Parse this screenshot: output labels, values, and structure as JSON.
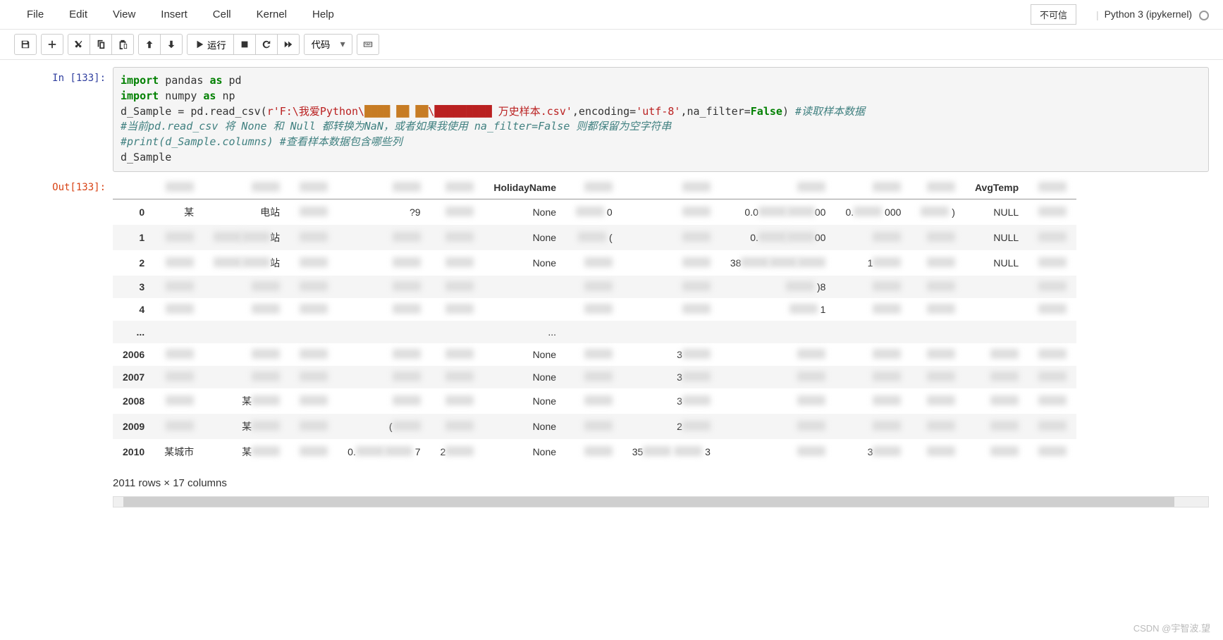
{
  "menubar": {
    "file": "File",
    "edit": "Edit",
    "view": "View",
    "insert": "Insert",
    "cell": "Cell",
    "kernel": "Kernel",
    "help": "Help",
    "trusted": "不可信",
    "kernel_name": "Python 3 (ipykernel)"
  },
  "toolbar": {
    "run_label": "运行",
    "cell_type": "代码"
  },
  "cell": {
    "in_prompt": "In  [133]:",
    "out_prompt": "Out[133]:",
    "code": {
      "l1_a": "import",
      "l1_b": " pandas ",
      "l1_c": "as",
      "l1_d": " pd",
      "l2_a": "import",
      "l2_b": " numpy ",
      "l2_c": "as",
      "l2_d": " np",
      "l3_a": "d_Sample = pd.read_csv(",
      "l3_b": "r'F:\\我爱Python\\",
      "l3_c": "████ ██ ██",
      "l3_d": "\\█████████ 万史样本.csv'",
      "l3_e": ",encoding=",
      "l3_f": "'utf-8'",
      "l3_g": ",na_filter=",
      "l3_h": "False",
      "l3_i": ") ",
      "l3_j": "#读取样本数据",
      "l4": "#当前pd.read_csv 将 None 和 Null 都转换为NaN，或者如果我使用 na_filter=False 则都保留为空字符串",
      "l5": "#print(d_Sample.columns) #查看样本数据包含哪些列",
      "l6": "d_Sample"
    }
  },
  "dataframe": {
    "headers": [
      "",
      "",
      "",
      "",
      "",
      "HolidayName",
      "",
      "",
      "",
      "",
      "",
      "AvgTemp",
      ""
    ],
    "rows": [
      {
        "idx": "0",
        "cells": [
          "某",
          "电站",
          "█",
          "?9",
          "█",
          "None",
          "█ 0",
          "█",
          "0.0██00",
          "0.█ 000",
          "█ )",
          "NULL",
          "█"
        ]
      },
      {
        "idx": "1",
        "cells": [
          "█",
          "██站",
          "█",
          "█",
          "█",
          "None",
          "█ (",
          "█",
          "0.██00",
          "█",
          "█",
          "NULL",
          "█"
        ]
      },
      {
        "idx": "2",
        "cells": [
          "█",
          "██站",
          "█",
          "█",
          "█",
          "None",
          "█",
          "█",
          "38███",
          "1█",
          "█",
          "NULL",
          "█"
        ]
      },
      {
        "idx": "3",
        "cells": [
          "█",
          "█",
          "█",
          "█",
          "█",
          "",
          "█",
          "█",
          "█ )8",
          "█",
          "█",
          "",
          "█"
        ]
      },
      {
        "idx": "4",
        "cells": [
          "█",
          "█",
          "█",
          "█",
          "█",
          "",
          "█",
          "█",
          "█ 1",
          "█",
          "█",
          "",
          "█"
        ]
      },
      {
        "idx": "...",
        "cells": [
          "",
          "",
          "",
          "",
          "",
          "...",
          "",
          "",
          "",
          "",
          "",
          "",
          ""
        ]
      },
      {
        "idx": "2006",
        "cells": [
          "█",
          "█",
          "█",
          "█",
          "█",
          "None",
          "█",
          "3█",
          "█",
          "█",
          "█",
          "█",
          "█"
        ]
      },
      {
        "idx": "2007",
        "cells": [
          "█",
          "█",
          "█",
          "█",
          "█",
          "None",
          "█",
          "3█",
          "█",
          "█",
          "█",
          "█",
          "█"
        ]
      },
      {
        "idx": "2008",
        "cells": [
          "█",
          "某█",
          "█",
          "█",
          "█",
          "None",
          "█",
          "3█",
          "█",
          "█",
          "█",
          "█",
          "█"
        ]
      },
      {
        "idx": "2009",
        "cells": [
          "█",
          "某█",
          "█",
          "(█",
          "█",
          "None",
          "█",
          "2█",
          "█",
          "█",
          "█",
          "█",
          "█"
        ]
      },
      {
        "idx": "2010",
        "cells": [
          "某城市",
          "某█",
          "█",
          "0.██ 7",
          "2█",
          "None",
          "█",
          "35█ █ 3",
          "█",
          "3█",
          "█",
          "█",
          "█"
        ]
      }
    ],
    "summary": "2011 rows × 17 columns"
  },
  "watermark": "CSDN @宇智波.望"
}
